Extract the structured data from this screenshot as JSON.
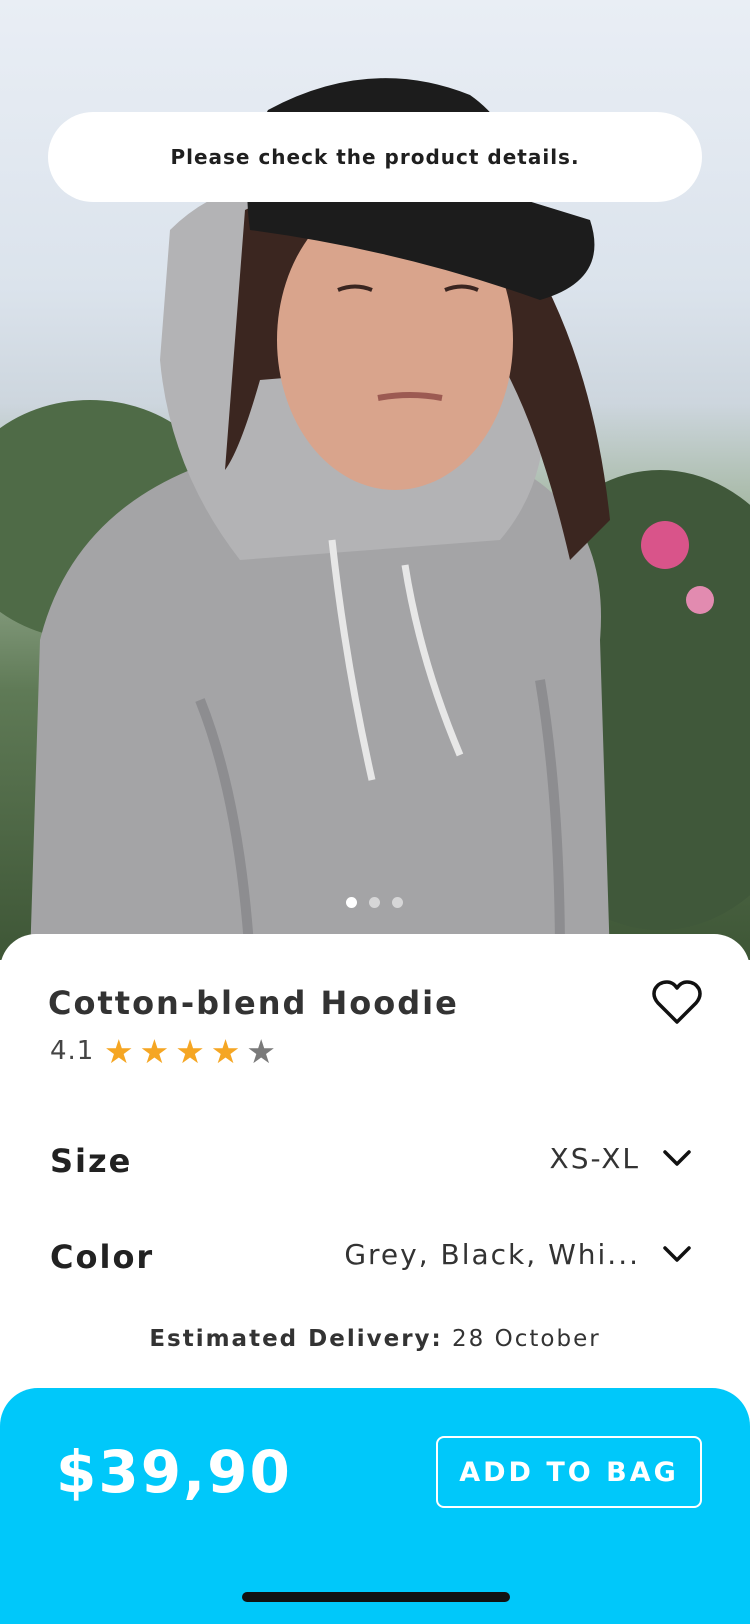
{
  "banner": {
    "message": "Please check the product details."
  },
  "gallery": {
    "dots": [
      true,
      false,
      false
    ]
  },
  "product": {
    "title": "Cotton-blend Hoodie",
    "rating": "4.1",
    "rating_level": 4,
    "stars": [
      "★",
      "★",
      "★",
      "★",
      "★"
    ],
    "star_colors": {
      "filled": "#f5a623",
      "empty": "#7a7a7a"
    }
  },
  "options": {
    "size": {
      "label": "Size",
      "value": "XS-XL"
    },
    "color": {
      "label": "Color",
      "value": "Grey, Black, Whi..."
    }
  },
  "delivery": {
    "label": "Estimated Delivery:",
    "date": "28 October"
  },
  "purchase": {
    "price": "$39,90",
    "button_label": "ADD TO BAG",
    "accent_color": "#00c8fa"
  }
}
